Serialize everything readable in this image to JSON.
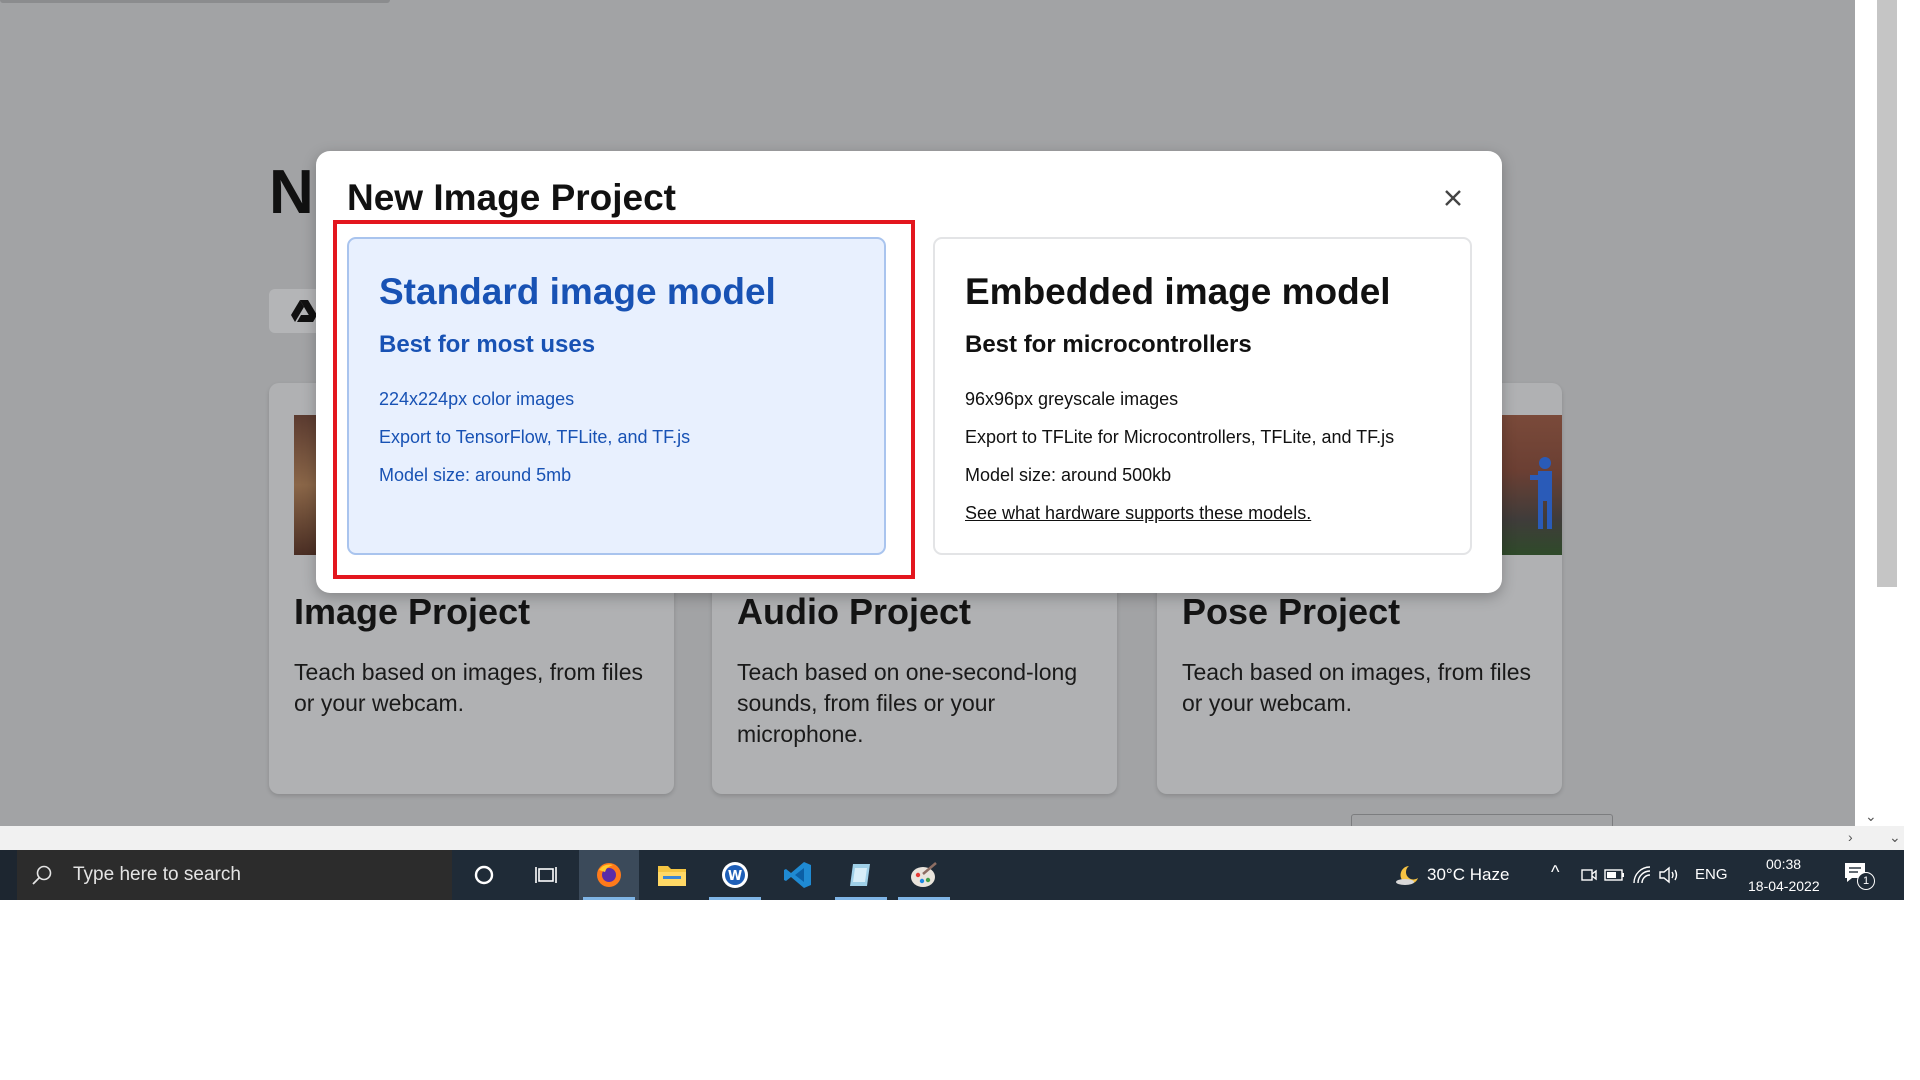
{
  "page": {
    "heading_partial": "N",
    "cards": [
      {
        "title": "Image Project",
        "desc": "Teach based on images, from files or your webcam."
      },
      {
        "title": "Audio Project",
        "desc": "Teach based on one-second-long sounds, from files or your microphone."
      },
      {
        "title": "Pose Project",
        "desc": "Teach based on images, from files or your webcam."
      }
    ]
  },
  "modal": {
    "title": "New Image Project",
    "standard": {
      "title": "Standard image model",
      "subtitle": "Best for most uses",
      "lines": [
        "224x224px color images",
        "Export to TensorFlow, TFLite, and TF.js",
        "Model size: around 5mb"
      ]
    },
    "embedded": {
      "title": "Embedded image model",
      "subtitle": "Best for microcontrollers",
      "lines": [
        "96x96px greyscale images",
        "Export to TFLite for Microcontrollers, TFLite, and TF.js",
        "Model size: around 500kb"
      ],
      "link": "See what hardware supports these models."
    }
  },
  "taskbar": {
    "search_placeholder": "Type here to search",
    "weather": "30°C  Haze",
    "language": "ENG",
    "time": "00:38",
    "date": "18-04-2022",
    "notification_count": "1"
  },
  "colors": {
    "accent_blue": "#1852b4",
    "link_blue": "#1a73e8",
    "highlight_red": "#e3161e",
    "overlay_gray": "#a2a3a5"
  }
}
